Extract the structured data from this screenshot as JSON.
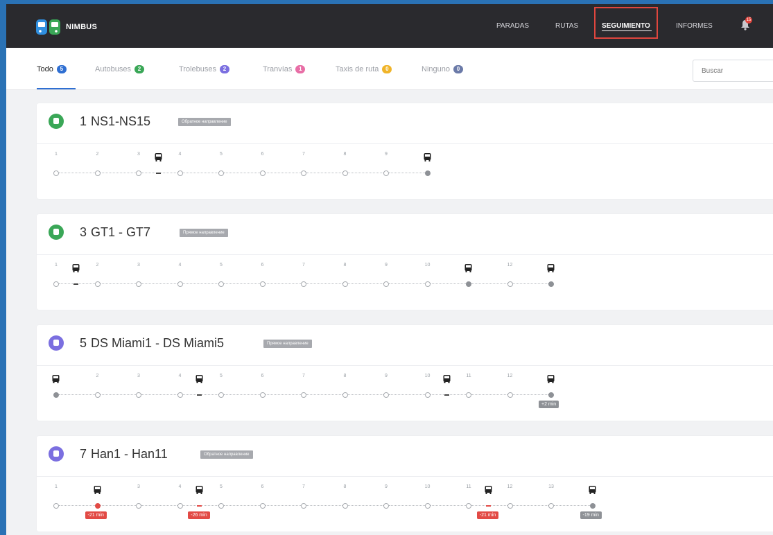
{
  "app": {
    "name": "NIMBUS"
  },
  "nav": {
    "items": [
      {
        "label": "PARADAS",
        "active": false
      },
      {
        "label": "RUTAS",
        "active": false
      },
      {
        "label": "SEGUIMIENTO",
        "active": true
      },
      {
        "label": "INFORMES",
        "active": false
      }
    ],
    "notifications_count": "15"
  },
  "filters": {
    "tabs": [
      {
        "label": "Todo",
        "count": "5",
        "color": "#2f6fd2",
        "active": true
      },
      {
        "label": "Autobuses",
        "count": "2",
        "color": "#3aa757",
        "active": false
      },
      {
        "label": "Trolebuses",
        "count": "2",
        "color": "#7b6fe0",
        "active": false
      },
      {
        "label": "Tranvías",
        "count": "1",
        "color": "#e86ea6",
        "active": false
      },
      {
        "label": "Taxis de ruta",
        "count": "0",
        "color": "#f0b429",
        "active": false
      },
      {
        "label": "Ninguno",
        "count": "0",
        "color": "#6b7aa8",
        "active": false
      }
    ],
    "search_placeholder": "Buscar"
  },
  "routes": [
    {
      "number": "1",
      "name": "NS1-NS15",
      "direction": "Обратное направление",
      "type_color": "#3aa757",
      "stops": [
        "1",
        "2",
        "3",
        "4",
        "5",
        "6",
        "7",
        "8",
        "9",
        ""
      ],
      "filled_stops": [
        9
      ],
      "buses_at_stops": [
        9
      ],
      "buses_between": [
        2
      ],
      "red_stops": [],
      "delays": []
    },
    {
      "number": "3",
      "name": "GT1 - GT7",
      "direction": "Прямое направление",
      "type_color": "#3aa757",
      "stops": [
        "1",
        "2",
        "3",
        "4",
        "5",
        "6",
        "7",
        "8",
        "9",
        "10",
        "",
        "12",
        ""
      ],
      "filled_stops": [
        10,
        12
      ],
      "buses_at_stops": [
        10,
        12
      ],
      "buses_between": [
        0
      ],
      "red_stops": [],
      "delays": []
    },
    {
      "number": "5",
      "name": "DS Miami1 - DS Miami5",
      "direction": "Прямое направление",
      "type_color": "#7b6fe0",
      "stops": [
        "",
        "2",
        "3",
        "4",
        "5",
        "6",
        "7",
        "8",
        "9",
        "10",
        "11",
        "12",
        ""
      ],
      "filled_stops": [
        0,
        12
      ],
      "buses_at_stops": [
        0,
        12
      ],
      "buses_between": [
        3,
        9
      ],
      "red_stops": [],
      "delays": [
        {
          "stop": 12,
          "text": "+2 min",
          "color": "#8e9196"
        }
      ]
    },
    {
      "number": "7",
      "name": "Han1 - Han11",
      "direction": "Обратное направление",
      "type_color": "#7b6fe0",
      "stops": [
        "1",
        "",
        "3",
        "4",
        "5",
        "6",
        "7",
        "8",
        "9",
        "10",
        "11",
        "12",
        "13",
        ""
      ],
      "filled_stops": [
        13
      ],
      "buses_at_stops": [
        1,
        13
      ],
      "buses_between": [
        3,
        10
      ],
      "red_stops": [
        1
      ],
      "delays": [
        {
          "stop": 1,
          "text": "-21 min",
          "color": "#e24a45"
        },
        {
          "stop": 3.5,
          "text": "-26 min",
          "color": "#e24a45"
        },
        {
          "stop": 10.5,
          "text": "-21 min",
          "color": "#e24a45"
        },
        {
          "stop": 13,
          "text": "-19 min",
          "color": "#8e9196"
        }
      ]
    }
  ]
}
